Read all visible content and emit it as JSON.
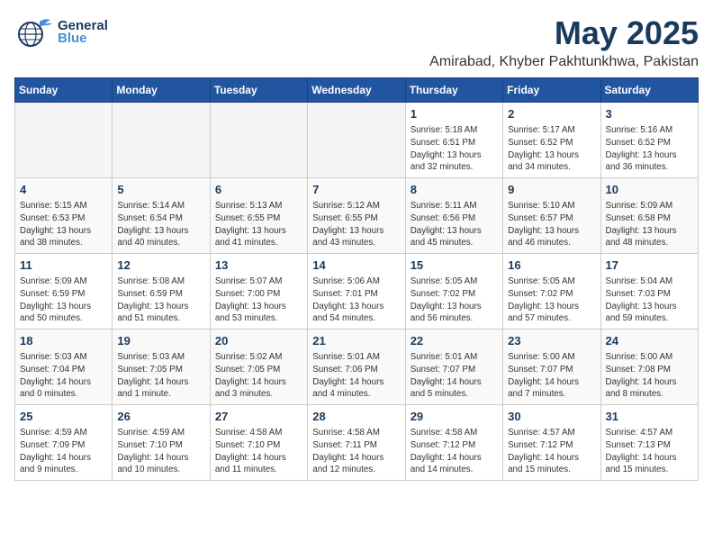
{
  "header": {
    "logo_line1": "General",
    "logo_line2": "Blue",
    "month": "May 2025",
    "location": "Amirabad, Khyber Pakhtunkhwa, Pakistan"
  },
  "weekdays": [
    "Sunday",
    "Monday",
    "Tuesday",
    "Wednesday",
    "Thursday",
    "Friday",
    "Saturday"
  ],
  "weeks": [
    [
      {
        "day": "",
        "info": ""
      },
      {
        "day": "",
        "info": ""
      },
      {
        "day": "",
        "info": ""
      },
      {
        "day": "",
        "info": ""
      },
      {
        "day": "1",
        "info": "Sunrise: 5:18 AM\nSunset: 6:51 PM\nDaylight: 13 hours\nand 32 minutes."
      },
      {
        "day": "2",
        "info": "Sunrise: 5:17 AM\nSunset: 6:52 PM\nDaylight: 13 hours\nand 34 minutes."
      },
      {
        "day": "3",
        "info": "Sunrise: 5:16 AM\nSunset: 6:52 PM\nDaylight: 13 hours\nand 36 minutes."
      }
    ],
    [
      {
        "day": "4",
        "info": "Sunrise: 5:15 AM\nSunset: 6:53 PM\nDaylight: 13 hours\nand 38 minutes."
      },
      {
        "day": "5",
        "info": "Sunrise: 5:14 AM\nSunset: 6:54 PM\nDaylight: 13 hours\nand 40 minutes."
      },
      {
        "day": "6",
        "info": "Sunrise: 5:13 AM\nSunset: 6:55 PM\nDaylight: 13 hours\nand 41 minutes."
      },
      {
        "day": "7",
        "info": "Sunrise: 5:12 AM\nSunset: 6:55 PM\nDaylight: 13 hours\nand 43 minutes."
      },
      {
        "day": "8",
        "info": "Sunrise: 5:11 AM\nSunset: 6:56 PM\nDaylight: 13 hours\nand 45 minutes."
      },
      {
        "day": "9",
        "info": "Sunrise: 5:10 AM\nSunset: 6:57 PM\nDaylight: 13 hours\nand 46 minutes."
      },
      {
        "day": "10",
        "info": "Sunrise: 5:09 AM\nSunset: 6:58 PM\nDaylight: 13 hours\nand 48 minutes."
      }
    ],
    [
      {
        "day": "11",
        "info": "Sunrise: 5:09 AM\nSunset: 6:59 PM\nDaylight: 13 hours\nand 50 minutes."
      },
      {
        "day": "12",
        "info": "Sunrise: 5:08 AM\nSunset: 6:59 PM\nDaylight: 13 hours\nand 51 minutes."
      },
      {
        "day": "13",
        "info": "Sunrise: 5:07 AM\nSunset: 7:00 PM\nDaylight: 13 hours\nand 53 minutes."
      },
      {
        "day": "14",
        "info": "Sunrise: 5:06 AM\nSunset: 7:01 PM\nDaylight: 13 hours\nand 54 minutes."
      },
      {
        "day": "15",
        "info": "Sunrise: 5:05 AM\nSunset: 7:02 PM\nDaylight: 13 hours\nand 56 minutes."
      },
      {
        "day": "16",
        "info": "Sunrise: 5:05 AM\nSunset: 7:02 PM\nDaylight: 13 hours\nand 57 minutes."
      },
      {
        "day": "17",
        "info": "Sunrise: 5:04 AM\nSunset: 7:03 PM\nDaylight: 13 hours\nand 59 minutes."
      }
    ],
    [
      {
        "day": "18",
        "info": "Sunrise: 5:03 AM\nSunset: 7:04 PM\nDaylight: 14 hours\nand 0 minutes."
      },
      {
        "day": "19",
        "info": "Sunrise: 5:03 AM\nSunset: 7:05 PM\nDaylight: 14 hours\nand 1 minute."
      },
      {
        "day": "20",
        "info": "Sunrise: 5:02 AM\nSunset: 7:05 PM\nDaylight: 14 hours\nand 3 minutes."
      },
      {
        "day": "21",
        "info": "Sunrise: 5:01 AM\nSunset: 7:06 PM\nDaylight: 14 hours\nand 4 minutes."
      },
      {
        "day": "22",
        "info": "Sunrise: 5:01 AM\nSunset: 7:07 PM\nDaylight: 14 hours\nand 5 minutes."
      },
      {
        "day": "23",
        "info": "Sunrise: 5:00 AM\nSunset: 7:07 PM\nDaylight: 14 hours\nand 7 minutes."
      },
      {
        "day": "24",
        "info": "Sunrise: 5:00 AM\nSunset: 7:08 PM\nDaylight: 14 hours\nand 8 minutes."
      }
    ],
    [
      {
        "day": "25",
        "info": "Sunrise: 4:59 AM\nSunset: 7:09 PM\nDaylight: 14 hours\nand 9 minutes."
      },
      {
        "day": "26",
        "info": "Sunrise: 4:59 AM\nSunset: 7:10 PM\nDaylight: 14 hours\nand 10 minutes."
      },
      {
        "day": "27",
        "info": "Sunrise: 4:58 AM\nSunset: 7:10 PM\nDaylight: 14 hours\nand 11 minutes."
      },
      {
        "day": "28",
        "info": "Sunrise: 4:58 AM\nSunset: 7:11 PM\nDaylight: 14 hours\nand 12 minutes."
      },
      {
        "day": "29",
        "info": "Sunrise: 4:58 AM\nSunset: 7:12 PM\nDaylight: 14 hours\nand 14 minutes."
      },
      {
        "day": "30",
        "info": "Sunrise: 4:57 AM\nSunset: 7:12 PM\nDaylight: 14 hours\nand 15 minutes."
      },
      {
        "day": "31",
        "info": "Sunrise: 4:57 AM\nSunset: 7:13 PM\nDaylight: 14 hours\nand 15 minutes."
      }
    ]
  ]
}
